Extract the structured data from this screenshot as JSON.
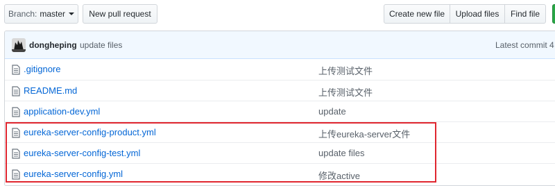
{
  "toolbar": {
    "branch_label": "Branch:",
    "branch_name": "master",
    "new_pr": "New pull request",
    "create_file": "Create new file",
    "upload_files": "Upload files",
    "find_file": "Find file"
  },
  "commit": {
    "author": "dongheping",
    "message": "update files",
    "latest": "Latest commit 4"
  },
  "files": [
    {
      "name": ".gitignore",
      "message": "上传测试文件"
    },
    {
      "name": "README.md",
      "message": "上传测试文件"
    },
    {
      "name": "application-dev.yml",
      "message": "update"
    },
    {
      "name": "eureka-server-config-product.yml",
      "message": "上传eureka-server文件"
    },
    {
      "name": "eureka-server-config-test.yml",
      "message": "update files"
    },
    {
      "name": "eureka-server-config.yml",
      "message": "修改active"
    }
  ],
  "colors": {
    "link": "#0366d6",
    "highlight": "#e0262f",
    "commit_bar": "#f1f8ff",
    "clone_button": "#28a745"
  }
}
